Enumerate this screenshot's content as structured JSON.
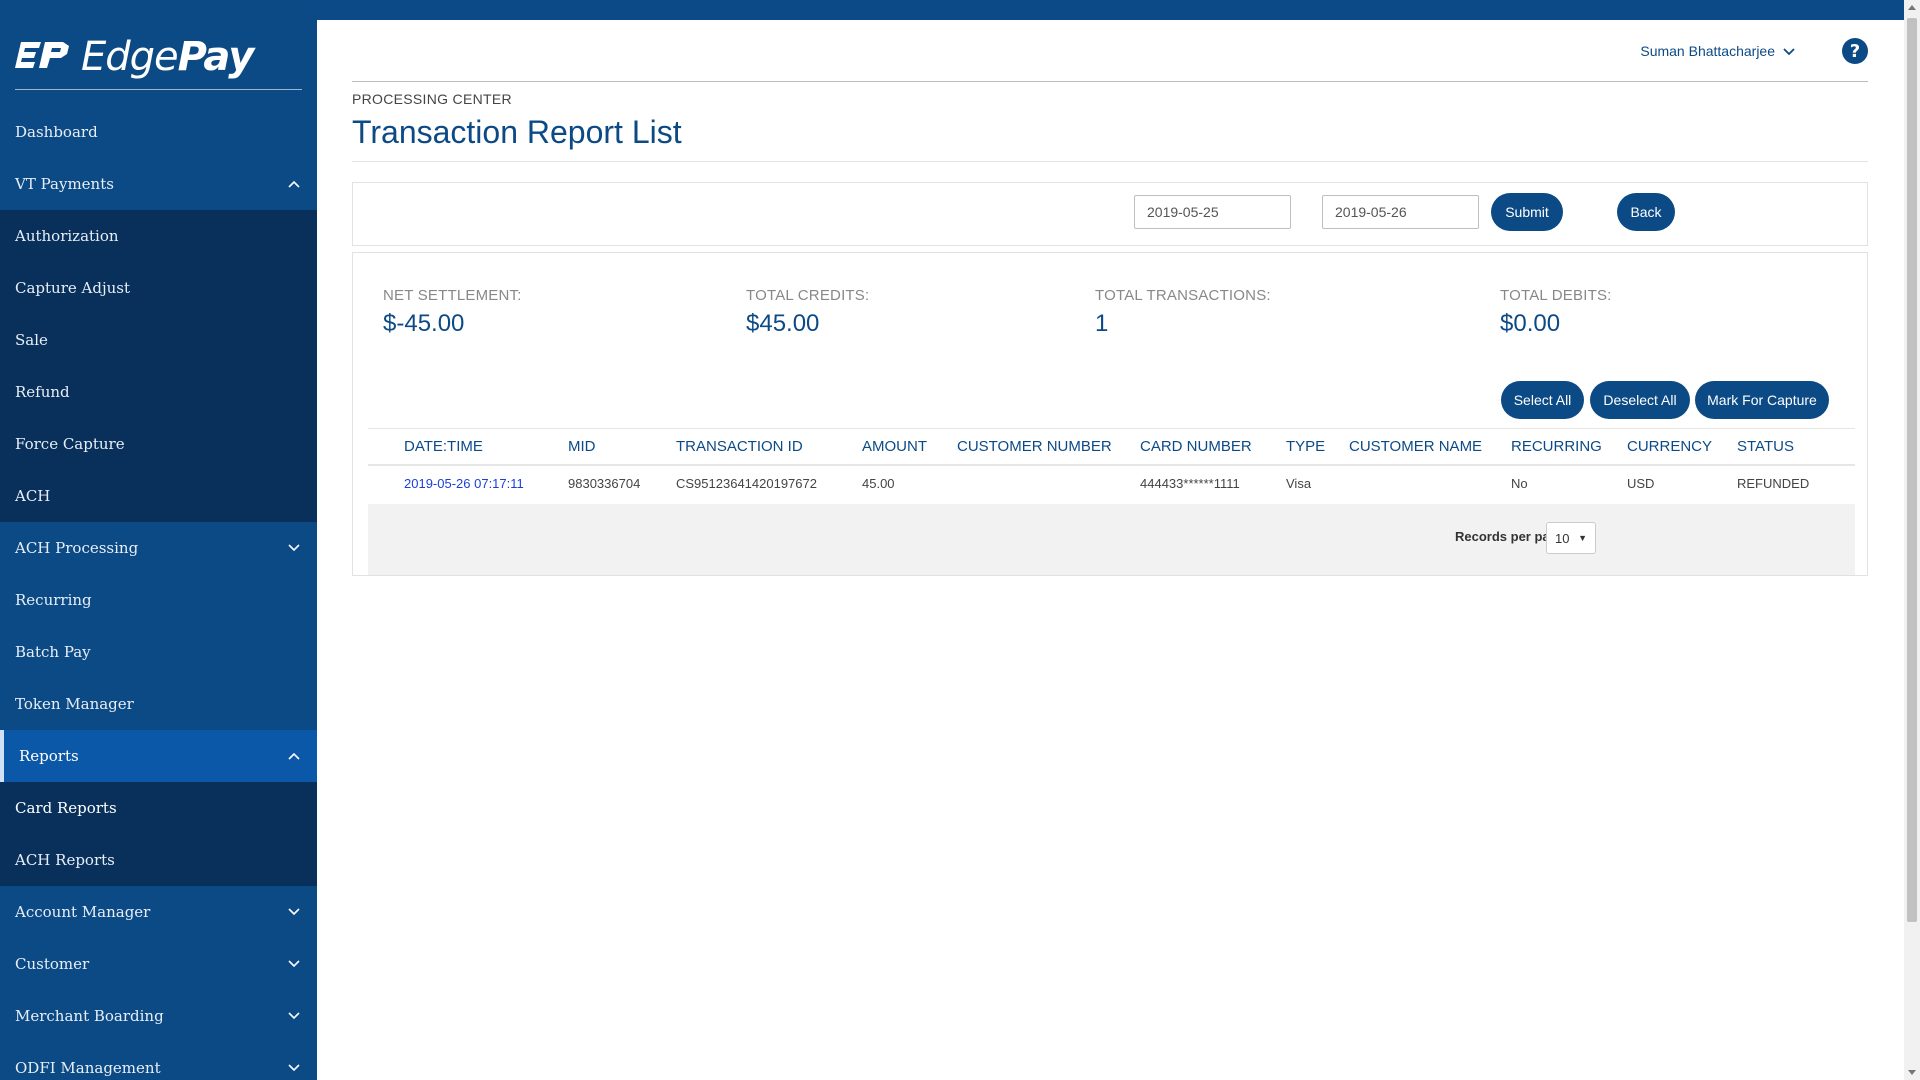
{
  "app": {
    "logo_text_light": "Edge",
    "logo_text_bold": "Pay",
    "logo_mark": "EP",
    "accent": "#0c4a86",
    "link_color": "#1a3fd9"
  },
  "sidebar": {
    "items": [
      {
        "label": "Dashboard",
        "chevron": ""
      },
      {
        "label": "VT Payments",
        "chevron": "up"
      },
      {
        "label": "Authorization",
        "chevron": ""
      },
      {
        "label": "Capture Adjust",
        "chevron": ""
      },
      {
        "label": "Sale",
        "chevron": ""
      },
      {
        "label": "Refund",
        "chevron": ""
      },
      {
        "label": "Force Capture",
        "chevron": ""
      },
      {
        "label": "ACH",
        "chevron": ""
      },
      {
        "label": "ACH Processing",
        "chevron": "down"
      },
      {
        "label": "Recurring",
        "chevron": ""
      },
      {
        "label": "Batch Pay",
        "chevron": ""
      },
      {
        "label": "Token Manager",
        "chevron": ""
      },
      {
        "label": "Reports",
        "chevron": "up"
      },
      {
        "label": "Card Reports",
        "chevron": ""
      },
      {
        "label": "ACH Reports",
        "chevron": ""
      },
      {
        "label": "Account Manager",
        "chevron": "down"
      },
      {
        "label": "Customer",
        "chevron": "down"
      },
      {
        "label": "Merchant Boarding",
        "chevron": "down"
      },
      {
        "label": "ODFI Management",
        "chevron": "down"
      }
    ]
  },
  "header": {
    "user_name": "Suman Bhattacharjee",
    "help_icon": "question-circle-icon",
    "breadcrumb": "PROCESSING CENTER",
    "title": "Transaction Report List"
  },
  "filter": {
    "start_date": "2019-05-25",
    "end_date": "2019-05-26",
    "submit_label": "Submit",
    "back_label": "Back"
  },
  "summary": {
    "net_settlement_label": "NET SETTLEMENT:",
    "net_settlement_value": "$-45.00",
    "total_credits_label": "TOTAL CREDITS:",
    "total_credits_value": "$45.00",
    "total_transactions_label": "TOTAL TRANSACTIONS:",
    "total_transactions_value": "1",
    "total_debits_label": "TOTAL DEBITS:",
    "total_debits_value": "$0.00"
  },
  "actions": {
    "select_all": "Select All",
    "deselect_all": "Deselect All",
    "mark_for_capture": "Mark For Capture"
  },
  "table": {
    "columns": [
      "DATE:TIME",
      "MID",
      "TRANSACTION ID",
      "AMOUNT",
      "CUSTOMER NUMBER",
      "CARD NUMBER",
      "TYPE",
      "CUSTOMER NAME",
      "RECURRING",
      "CURRENCY",
      "STATUS"
    ],
    "rows": [
      [
        "2019-05-26 07:17:11",
        "9830336704",
        "CS95123641420197672",
        "45.00",
        "",
        "444433******1111",
        "Visa",
        "",
        "No",
        "USD",
        "REFUNDED"
      ]
    ],
    "records_per_page_label": "Records per page:",
    "records_per_page_value": "10"
  }
}
